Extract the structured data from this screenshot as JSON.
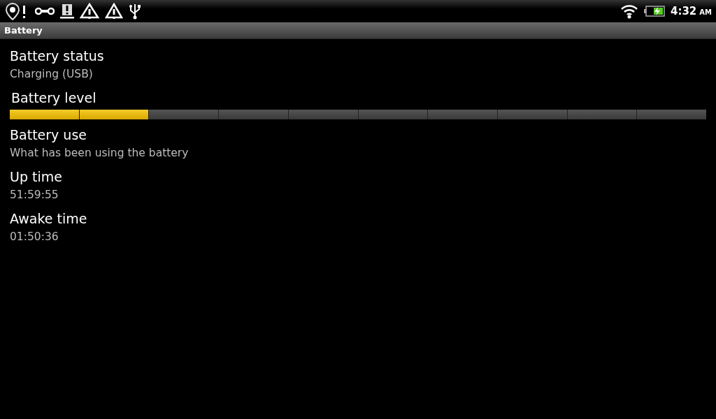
{
  "status_bar": {
    "time": "4:32",
    "meridiem": "AM"
  },
  "title": "Battery",
  "items": [
    {
      "kind": "text",
      "title": "Battery status",
      "subtitle": "Charging (USB)"
    },
    {
      "kind": "meter",
      "title": "Battery level",
      "level": 0.2
    },
    {
      "kind": "text",
      "title": "Battery use",
      "subtitle": "What has been using the battery"
    },
    {
      "kind": "text",
      "title": "Up time",
      "subtitle": "51:59:55"
    },
    {
      "kind": "text",
      "title": "Awake time",
      "subtitle": "01:50:36"
    }
  ]
}
